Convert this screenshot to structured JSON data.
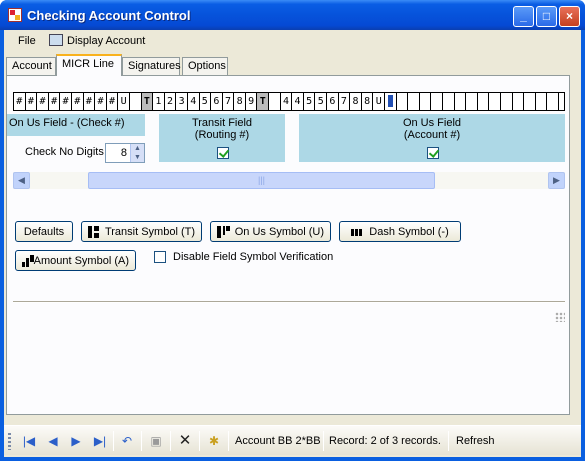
{
  "window": {
    "title": "Checking Account Control"
  },
  "menu": {
    "file": "File",
    "display_account": "Display Account"
  },
  "tabs": [
    "Account",
    "MICR Line",
    "Signatures",
    "Options"
  ],
  "micr": {
    "cells": [
      "#",
      "#",
      "#",
      "#",
      "#",
      "#",
      "#",
      "#",
      "#",
      "U",
      "",
      "T",
      "1",
      "2",
      "3",
      "4",
      "5",
      "6",
      "7",
      "8",
      "9",
      "T",
      "",
      "4",
      "4",
      "5",
      "5",
      "6",
      "7",
      "8",
      "8",
      "U",
      "",
      "",
      "",
      "",
      "",
      "",
      "",
      "",
      "",
      "",
      "",
      "",
      "",
      "",
      ""
    ]
  },
  "fields": {
    "check": {
      "label": "On Us Field - (Check #)",
      "digits_label": "Check No Digits",
      "digits_value": "8"
    },
    "transit": {
      "line1": "Transit Field",
      "line2": "(Routing #)",
      "checked": true
    },
    "onus": {
      "line1": "On Us Field",
      "line2": "(Account #)",
      "checked": true
    }
  },
  "buttons": {
    "defaults": "Defaults",
    "transit": "Transit Symbol (T)",
    "onus": "On Us Symbol (U)",
    "dash": "Dash Symbol (-)",
    "amount": "Amount Symbol (A)"
  },
  "options": {
    "disable_verification": "Disable Field Symbol Verification",
    "disable_verification_checked": false
  },
  "toolbar": {
    "account": "Account BB 2*BB",
    "record": "Record: 2 of 3 records.",
    "refresh": "Refresh"
  },
  "colors": {
    "field_bg": "#add8e6",
    "titlebar": "#0653db",
    "panel": "#ece9d8"
  }
}
